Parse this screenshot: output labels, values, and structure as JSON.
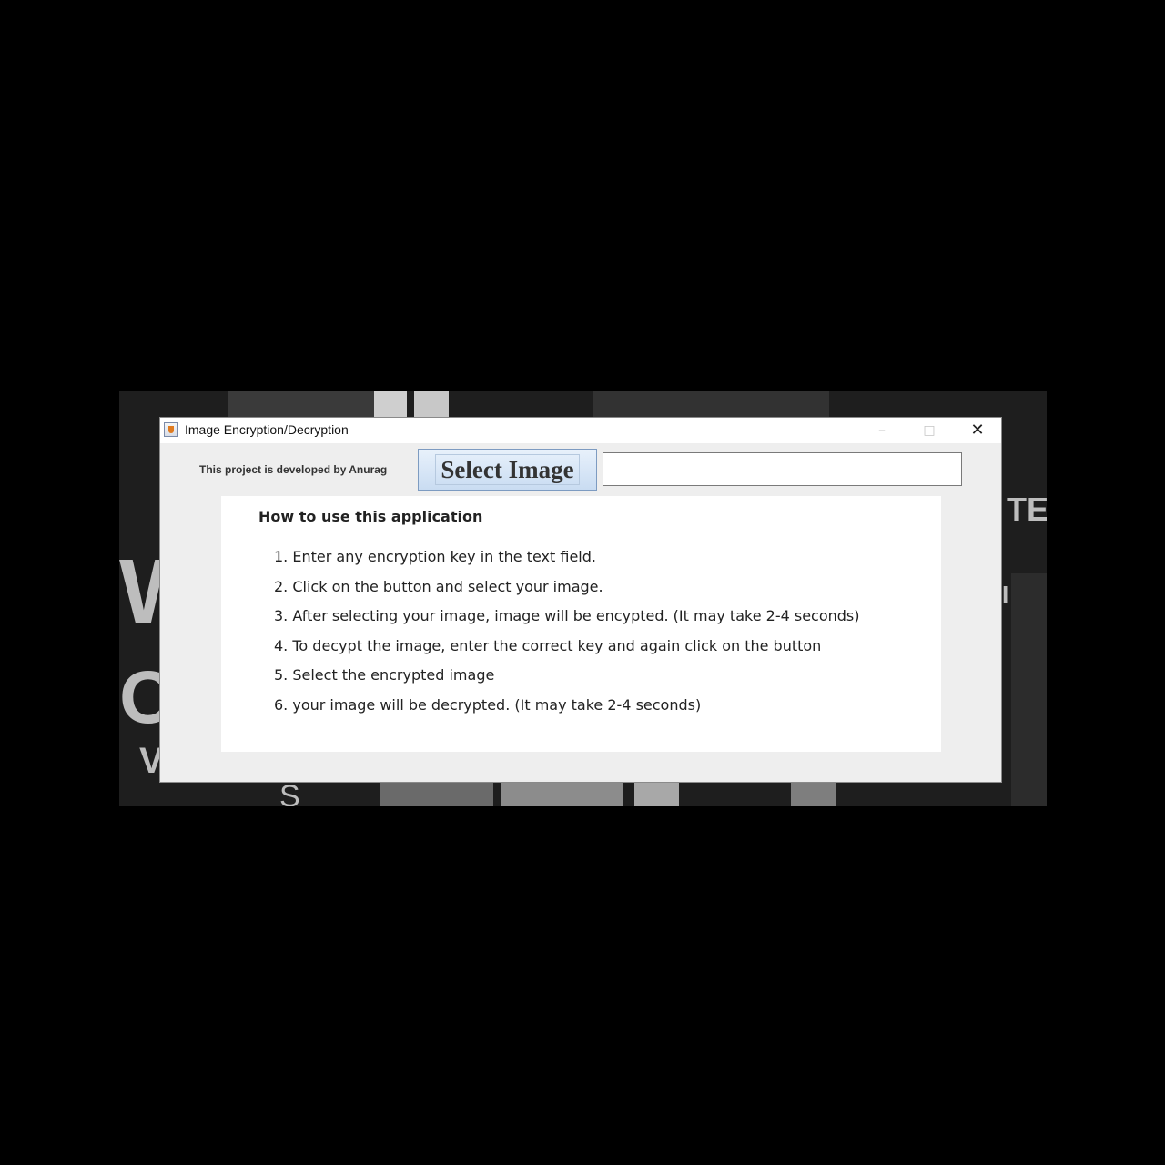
{
  "window": {
    "title": "Image Encryption/Decryption",
    "controls": {
      "minimize": "–",
      "maximize": "□",
      "close": "✕"
    },
    "app_icon": "java-cup-icon"
  },
  "toolbar": {
    "credit_label": "This project is developed by Anurag",
    "select_image_label": "Select Image",
    "key_field_value": "",
    "key_field_placeholder": ""
  },
  "help": {
    "heading": "How to use this application",
    "steps": [
      "1. Enter any encryption key in the text field.",
      "2. Click on the button and select your image.",
      "3. After selecting your image, image will be encypted. (It may take 2-4 seconds)",
      "4. To decypt the image, enter the correct key and again click on the button",
      "5. Select the encrypted image",
      "6. your image will be decrypted. (It may take 2-4 seconds)"
    ]
  },
  "background": {
    "visible_letters": [
      "W",
      "O",
      "V",
      "S",
      "TE",
      "I"
    ]
  },
  "colors": {
    "screen_background": "#000000",
    "window_background": "#eeeeee",
    "panel_background": "#ffffff",
    "button_accent": "#c9dcf2"
  }
}
